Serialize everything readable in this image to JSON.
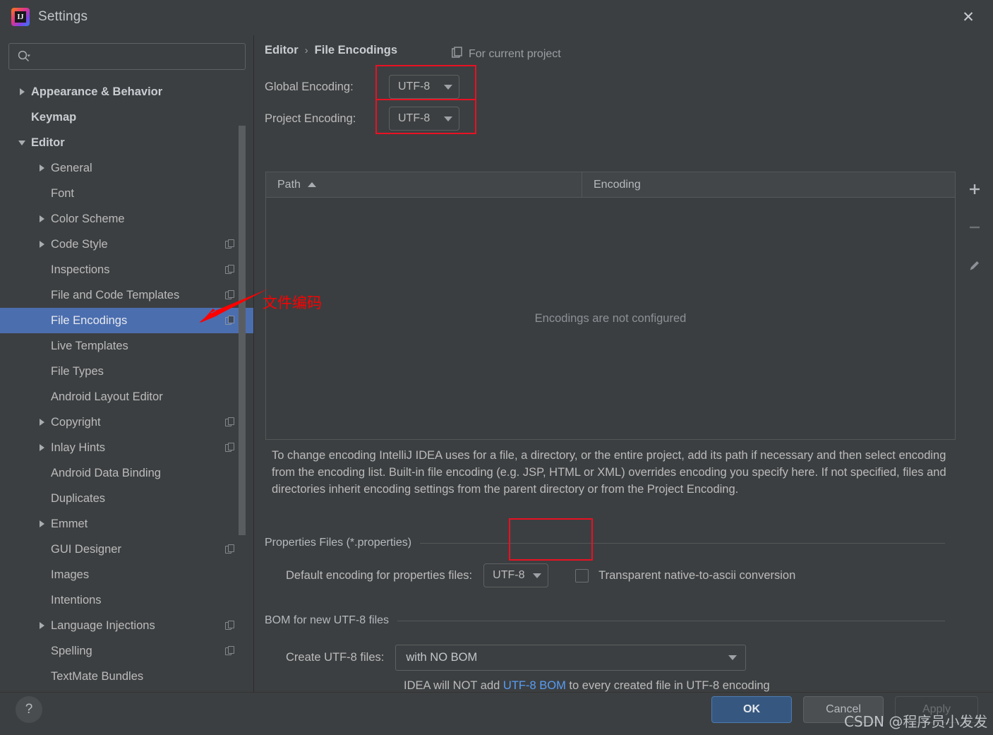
{
  "window": {
    "title": "Settings",
    "close_label": "✕",
    "logo_letter": "IJ"
  },
  "sidebar": {
    "search_placeholder": "",
    "search_value": "",
    "items": [
      {
        "label": "Appearance & Behavior",
        "indent": 0,
        "arrow": "right",
        "bold": true,
        "copy": false,
        "selected": false
      },
      {
        "label": "Keymap",
        "indent": 0,
        "arrow": "none",
        "bold": true,
        "copy": false,
        "selected": false
      },
      {
        "label": "Editor",
        "indent": 0,
        "arrow": "down",
        "bold": true,
        "copy": false,
        "selected": false
      },
      {
        "label": "General",
        "indent": 1,
        "arrow": "right",
        "bold": false,
        "copy": false,
        "selected": false
      },
      {
        "label": "Font",
        "indent": 1,
        "arrow": "none",
        "bold": false,
        "copy": false,
        "selected": false
      },
      {
        "label": "Color Scheme",
        "indent": 1,
        "arrow": "right",
        "bold": false,
        "copy": false,
        "selected": false
      },
      {
        "label": "Code Style",
        "indent": 1,
        "arrow": "right",
        "bold": false,
        "copy": true,
        "selected": false
      },
      {
        "label": "Inspections",
        "indent": 1,
        "arrow": "none",
        "bold": false,
        "copy": true,
        "selected": false
      },
      {
        "label": "File and Code Templates",
        "indent": 1,
        "arrow": "none",
        "bold": false,
        "copy": true,
        "selected": false
      },
      {
        "label": "File Encodings",
        "indent": 1,
        "arrow": "none",
        "bold": false,
        "copy": true,
        "selected": true
      },
      {
        "label": "Live Templates",
        "indent": 1,
        "arrow": "none",
        "bold": false,
        "copy": false,
        "selected": false
      },
      {
        "label": "File Types",
        "indent": 1,
        "arrow": "none",
        "bold": false,
        "copy": false,
        "selected": false
      },
      {
        "label": "Android Layout Editor",
        "indent": 1,
        "arrow": "none",
        "bold": false,
        "copy": false,
        "selected": false
      },
      {
        "label": "Copyright",
        "indent": 1,
        "arrow": "right",
        "bold": false,
        "copy": true,
        "selected": false
      },
      {
        "label": "Inlay Hints",
        "indent": 1,
        "arrow": "right",
        "bold": false,
        "copy": true,
        "selected": false
      },
      {
        "label": "Android Data Binding",
        "indent": 1,
        "arrow": "none",
        "bold": false,
        "copy": false,
        "selected": false
      },
      {
        "label": "Duplicates",
        "indent": 1,
        "arrow": "none",
        "bold": false,
        "copy": false,
        "selected": false
      },
      {
        "label": "Emmet",
        "indent": 1,
        "arrow": "right",
        "bold": false,
        "copy": false,
        "selected": false
      },
      {
        "label": "GUI Designer",
        "indent": 1,
        "arrow": "none",
        "bold": false,
        "copy": true,
        "selected": false
      },
      {
        "label": "Images",
        "indent": 1,
        "arrow": "none",
        "bold": false,
        "copy": false,
        "selected": false
      },
      {
        "label": "Intentions",
        "indent": 1,
        "arrow": "none",
        "bold": false,
        "copy": false,
        "selected": false
      },
      {
        "label": "Language Injections",
        "indent": 1,
        "arrow": "right",
        "bold": false,
        "copy": true,
        "selected": false
      },
      {
        "label": "Spelling",
        "indent": 1,
        "arrow": "none",
        "bold": false,
        "copy": true,
        "selected": false
      },
      {
        "label": "TextMate Bundles",
        "indent": 1,
        "arrow": "none",
        "bold": false,
        "copy": false,
        "selected": false
      }
    ]
  },
  "content": {
    "breadcrumb_parent": "Editor",
    "breadcrumb_sep": "›",
    "breadcrumb_current": "File Encodings",
    "for_current_project": "For current project",
    "global_encoding_label": "Global Encoding:",
    "global_encoding_value": "UTF-8",
    "project_encoding_label": "Project Encoding:",
    "project_encoding_value": "UTF-8",
    "table": {
      "col_path": "Path",
      "col_encoding": "Encoding",
      "empty_message": "Encodings are not configured",
      "add_label": "+",
      "remove_label": "−",
      "edit_label": "edit"
    },
    "description": "To change encoding IntelliJ IDEA uses for a file, a directory, or the entire project, add its path if necessary and then select encoding from the encoding list. Built-in file encoding (e.g. JSP, HTML or XML) overrides encoding you specify here. If not specified, files and directories inherit encoding settings from the parent directory or from the Project Encoding.",
    "properties_group": "Properties Files (*.properties)",
    "properties_encoding_label": "Default encoding for properties files:",
    "properties_encoding_value": "UTF-8",
    "transparent_checkbox_label": "Transparent native-to-ascii conversion",
    "bom_group": "BOM for new UTF-8 files",
    "create_utf8_label": "Create UTF-8 files:",
    "create_utf8_value": "with NO BOM",
    "bom_note_before": "IDEA will NOT add ",
    "bom_note_link": "UTF-8 BOM",
    "bom_note_after": " to every created file in UTF-8 encoding"
  },
  "footer": {
    "help_label": "?",
    "ok_label": "OK",
    "cancel_label": "Cancel",
    "apply_label": "Apply"
  },
  "annotations": {
    "callout_text": "文件编码",
    "watermark": "CSDN @程序员小发发"
  },
  "colors": {
    "background": "#3C3F41",
    "selection": "#4B6EAF",
    "accent_link": "#589DF6",
    "annotation_red": "#FF0000",
    "ok_button": "#365880"
  }
}
